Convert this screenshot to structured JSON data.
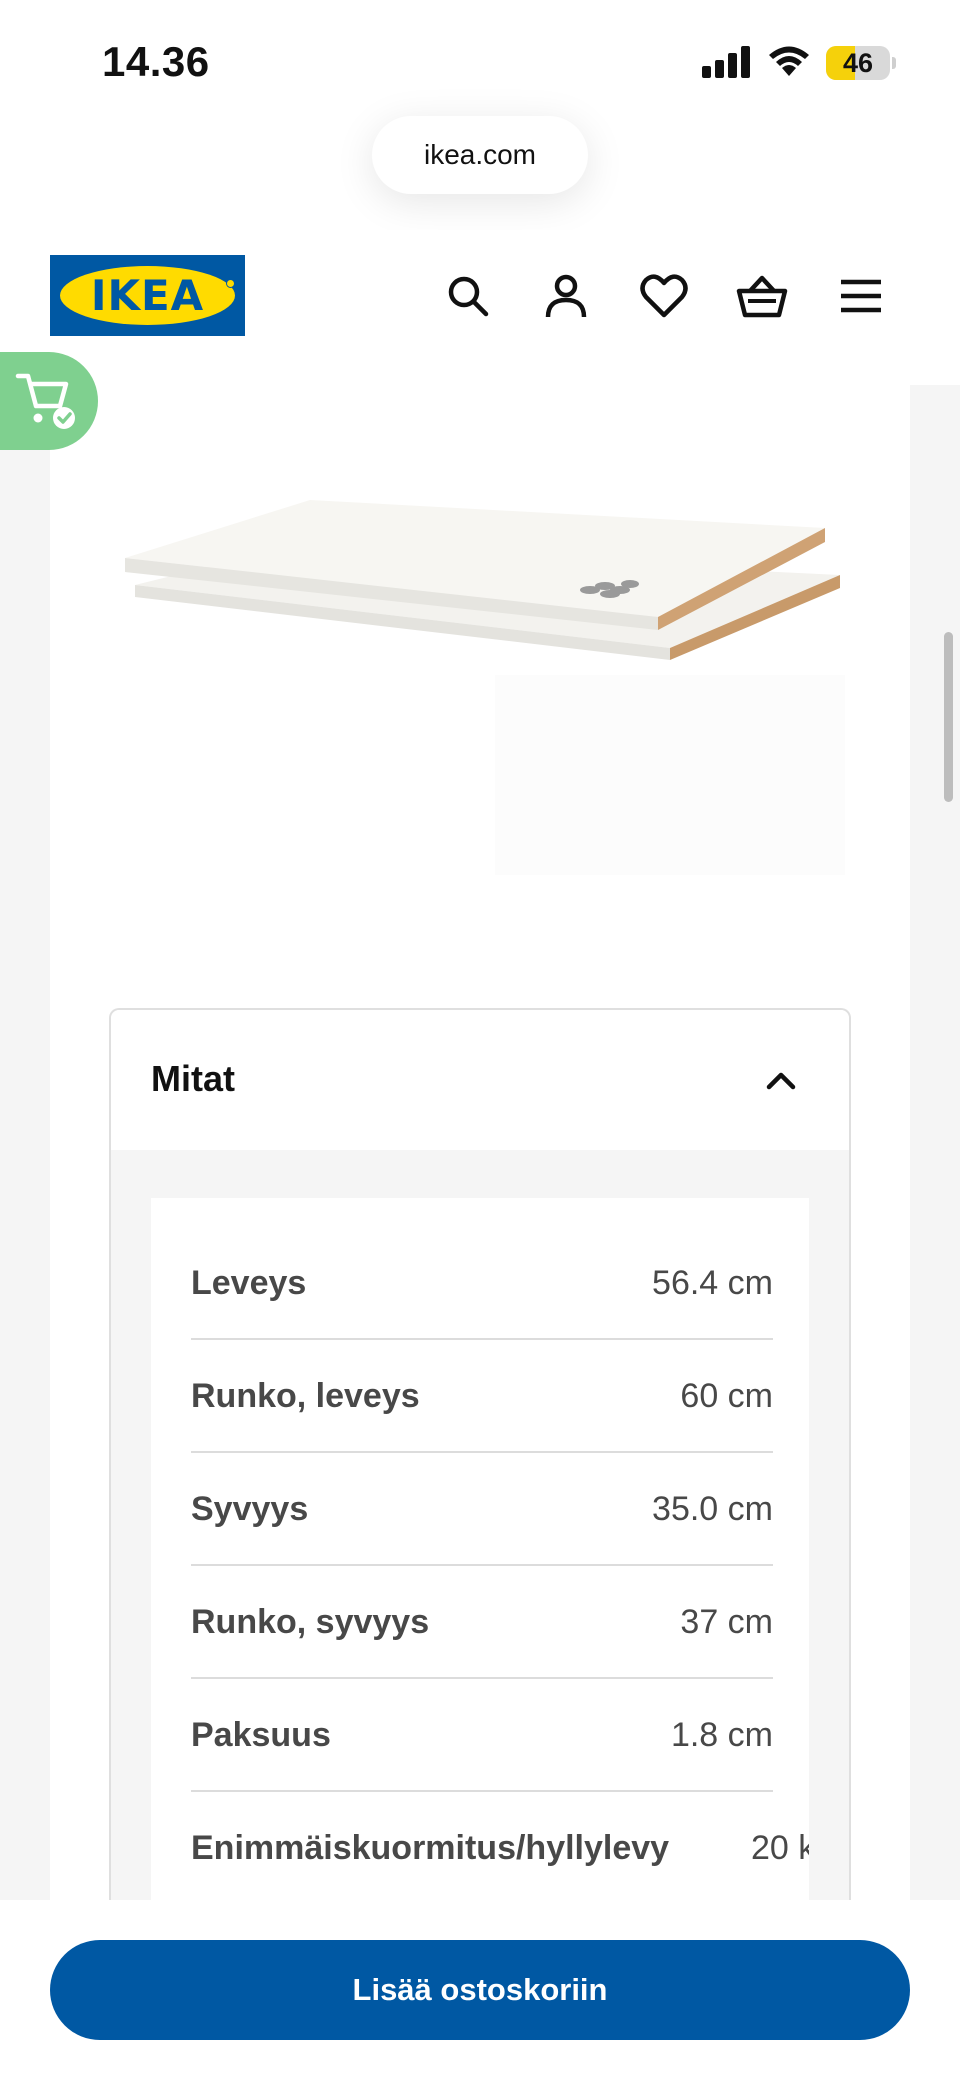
{
  "status_bar": {
    "time": "14.36",
    "battery_level": "46",
    "battery_color": "#f5d10b"
  },
  "browser": {
    "url": "ikea.com"
  },
  "header": {
    "logo_text": "IKEA",
    "brand_blue": "#0058a3",
    "brand_yellow": "#ffdb00",
    "icons": [
      "search-icon",
      "account-icon",
      "heart-icon",
      "basket-icon",
      "menu-icon"
    ]
  },
  "cart_tab": {
    "icon": "cart-check-icon",
    "color": "#7fd08f"
  },
  "accordion": {
    "title": "Mitat",
    "expanded": true,
    "rows": [
      {
        "label": "Leveys",
        "value": "56.4 cm"
      },
      {
        "label": "Runko, leveys",
        "value": "60 cm"
      },
      {
        "label": "Syvyys",
        "value": "35.0 cm"
      },
      {
        "label": "Runko, syvyys",
        "value": "37 cm"
      },
      {
        "label": "Paksuus",
        "value": "1.8 cm"
      },
      {
        "label": "Enimmäiskuormitus/hyllylevy",
        "value": "20 k"
      }
    ]
  },
  "cta": {
    "label": "Lisää ostoskoriin"
  }
}
